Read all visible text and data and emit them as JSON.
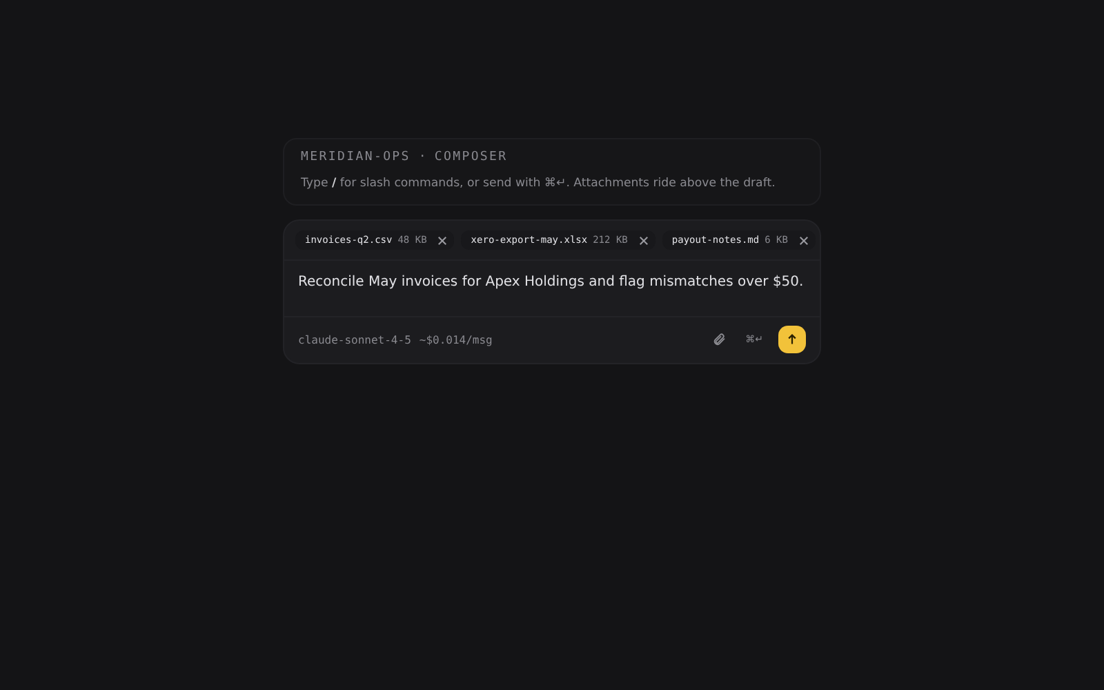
{
  "header": {
    "workspace": "MERIDIAN-OPS",
    "separator": "·",
    "section": "COMPOSER",
    "hint": "Type **/** for slash commands, or send with ⌘↵. Attachments ride above the draft."
  },
  "attachments": [
    {
      "name": "invoices-q2.csv",
      "size": "48 KB"
    },
    {
      "name": "xero-export-may.xlsx",
      "size": "212 KB"
    },
    {
      "name": "payout-notes.md",
      "size": "6 KB"
    }
  ],
  "draft": "Reconcile May invoices for Apex Holdings and flag mismatches over $50.",
  "footer": {
    "model": "claude-sonnet-4-5",
    "cost": "~$0.014/msg",
    "shortcut": "⌘↵"
  }
}
